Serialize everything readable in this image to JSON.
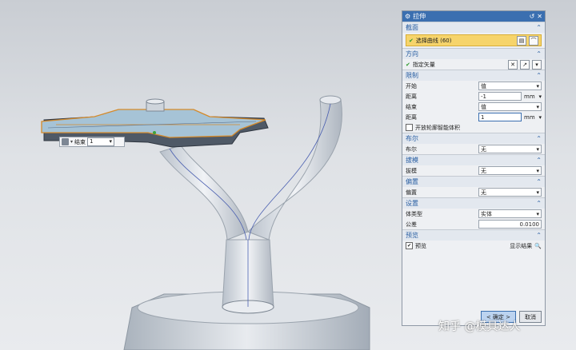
{
  "dialog": {
    "title": "拉伸",
    "sections": {
      "section": {
        "title": "截面",
        "select_curve": "选择曲线 (60)"
      },
      "direction": {
        "title": "方向",
        "vector_label": "指定矢量"
      },
      "limits": {
        "title": "限制",
        "start_label": "开始",
        "start_value": "值",
        "distance1_label": "距离",
        "distance1_value": "-1",
        "unit1": "mm",
        "end_label": "结束",
        "end_value": "值",
        "distance2_label": "距离",
        "distance2_value": "1",
        "unit2": "mm",
        "open_profile_label": "开放轮廓智能体积"
      },
      "boolean": {
        "title": "布尔",
        "label": "布尔",
        "value": "无"
      },
      "draft": {
        "title": "拔模",
        "label": "拔模",
        "value": "无"
      },
      "offset": {
        "title": "偏置",
        "label": "偏置",
        "value": "无"
      },
      "settings": {
        "title": "设置",
        "body_type_label": "体类型",
        "body_type_value": "实体",
        "tolerance_label": "公差",
        "tolerance_value": "0.0100"
      },
      "preview": {
        "title": "预览",
        "preview_label": "预览",
        "show_result": "显示结果"
      }
    },
    "ok_label": "< 确定 >",
    "cancel_label": "取消"
  },
  "mini_toolbar": {
    "end_label": "结束",
    "end_value": "1"
  },
  "watermark": "知乎 @模具达人"
}
